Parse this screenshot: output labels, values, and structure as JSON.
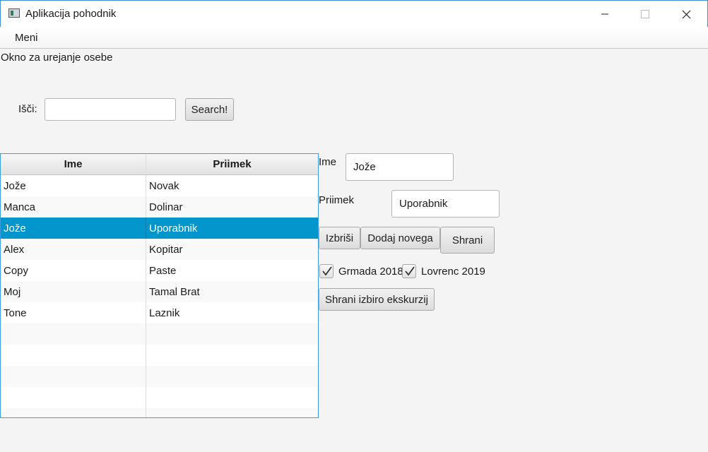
{
  "window": {
    "title": "Aplikacija pohodnik"
  },
  "menu": {
    "items": [
      {
        "label": "Meni"
      }
    ]
  },
  "header": {
    "text": "Okno za urejanje osebe"
  },
  "search": {
    "label": "Išči:",
    "value": "",
    "placeholder": "",
    "button_label": "Search!"
  },
  "table": {
    "columns": [
      "Ime",
      "Priimek"
    ],
    "rows": [
      {
        "ime": "Jože",
        "priimek": "Novak"
      },
      {
        "ime": "Manca",
        "priimek": "Dolinar"
      },
      {
        "ime": "Jože",
        "priimek": "Uporabnik"
      },
      {
        "ime": "Alex",
        "priimek": "Kopitar"
      },
      {
        "ime": "Copy",
        "priimek": "Paste"
      },
      {
        "ime": "Moj",
        "priimek": "Tamal Brat"
      },
      {
        "ime": "Tone",
        "priimek": "Laznik"
      }
    ],
    "selected_row": 2
  },
  "form": {
    "ime_label": "Ime",
    "ime_value": "Jože",
    "priimek_label": "Priimek",
    "priimek_value": "Uporabnik",
    "delete_button": "Izbriši",
    "add_button": "Dodaj novega",
    "save_button": "Shrani",
    "excursions": [
      {
        "label": "Grmada 2018",
        "checked": true
      },
      {
        "label": "Lovrenc 2019",
        "checked": true
      }
    ],
    "save_excursions_button": "Shrani izbiro ekskurzij"
  },
  "colors": {
    "selection": "#0396cc",
    "focus_border": "#3a9fdc"
  }
}
